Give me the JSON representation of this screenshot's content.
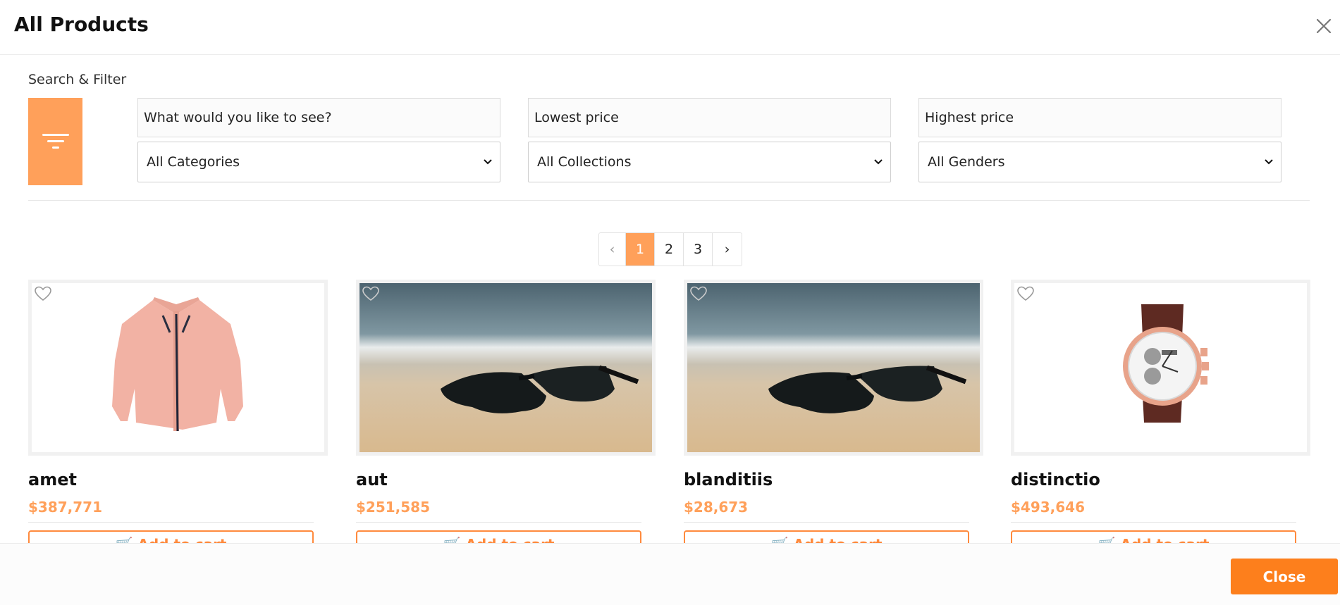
{
  "modal": {
    "title": "All Products",
    "close_label": "Close"
  },
  "filter": {
    "section_label": "Search & Filter",
    "search_placeholder": "What would you like to see?",
    "min_price_placeholder": "Lowest price",
    "max_price_placeholder": "Highest price",
    "category_selected": "All Categories",
    "collection_selected": "All Collections",
    "gender_selected": "All Genders"
  },
  "pagination": {
    "prev": "‹",
    "pages": [
      "1",
      "2",
      "3"
    ],
    "active_page": "1",
    "next": "›"
  },
  "products": [
    {
      "name": "amet",
      "price": "$387,771",
      "image": "pink-shirt",
      "add_label": "Add to cart"
    },
    {
      "name": "aut",
      "price": "$251,585",
      "image": "sunglasses-on-beach",
      "add_label": "Add to cart"
    },
    {
      "name": "blanditiis",
      "price": "$28,673",
      "image": "sunglasses-on-beach",
      "add_label": "Add to cart"
    },
    {
      "name": "distinctio",
      "price": "$493,646",
      "image": "rose-gold-wristwatch",
      "add_label": "Add to cart"
    }
  ],
  "colors": {
    "accent": "#ffa05a",
    "close_button": "#fd7f1c"
  }
}
